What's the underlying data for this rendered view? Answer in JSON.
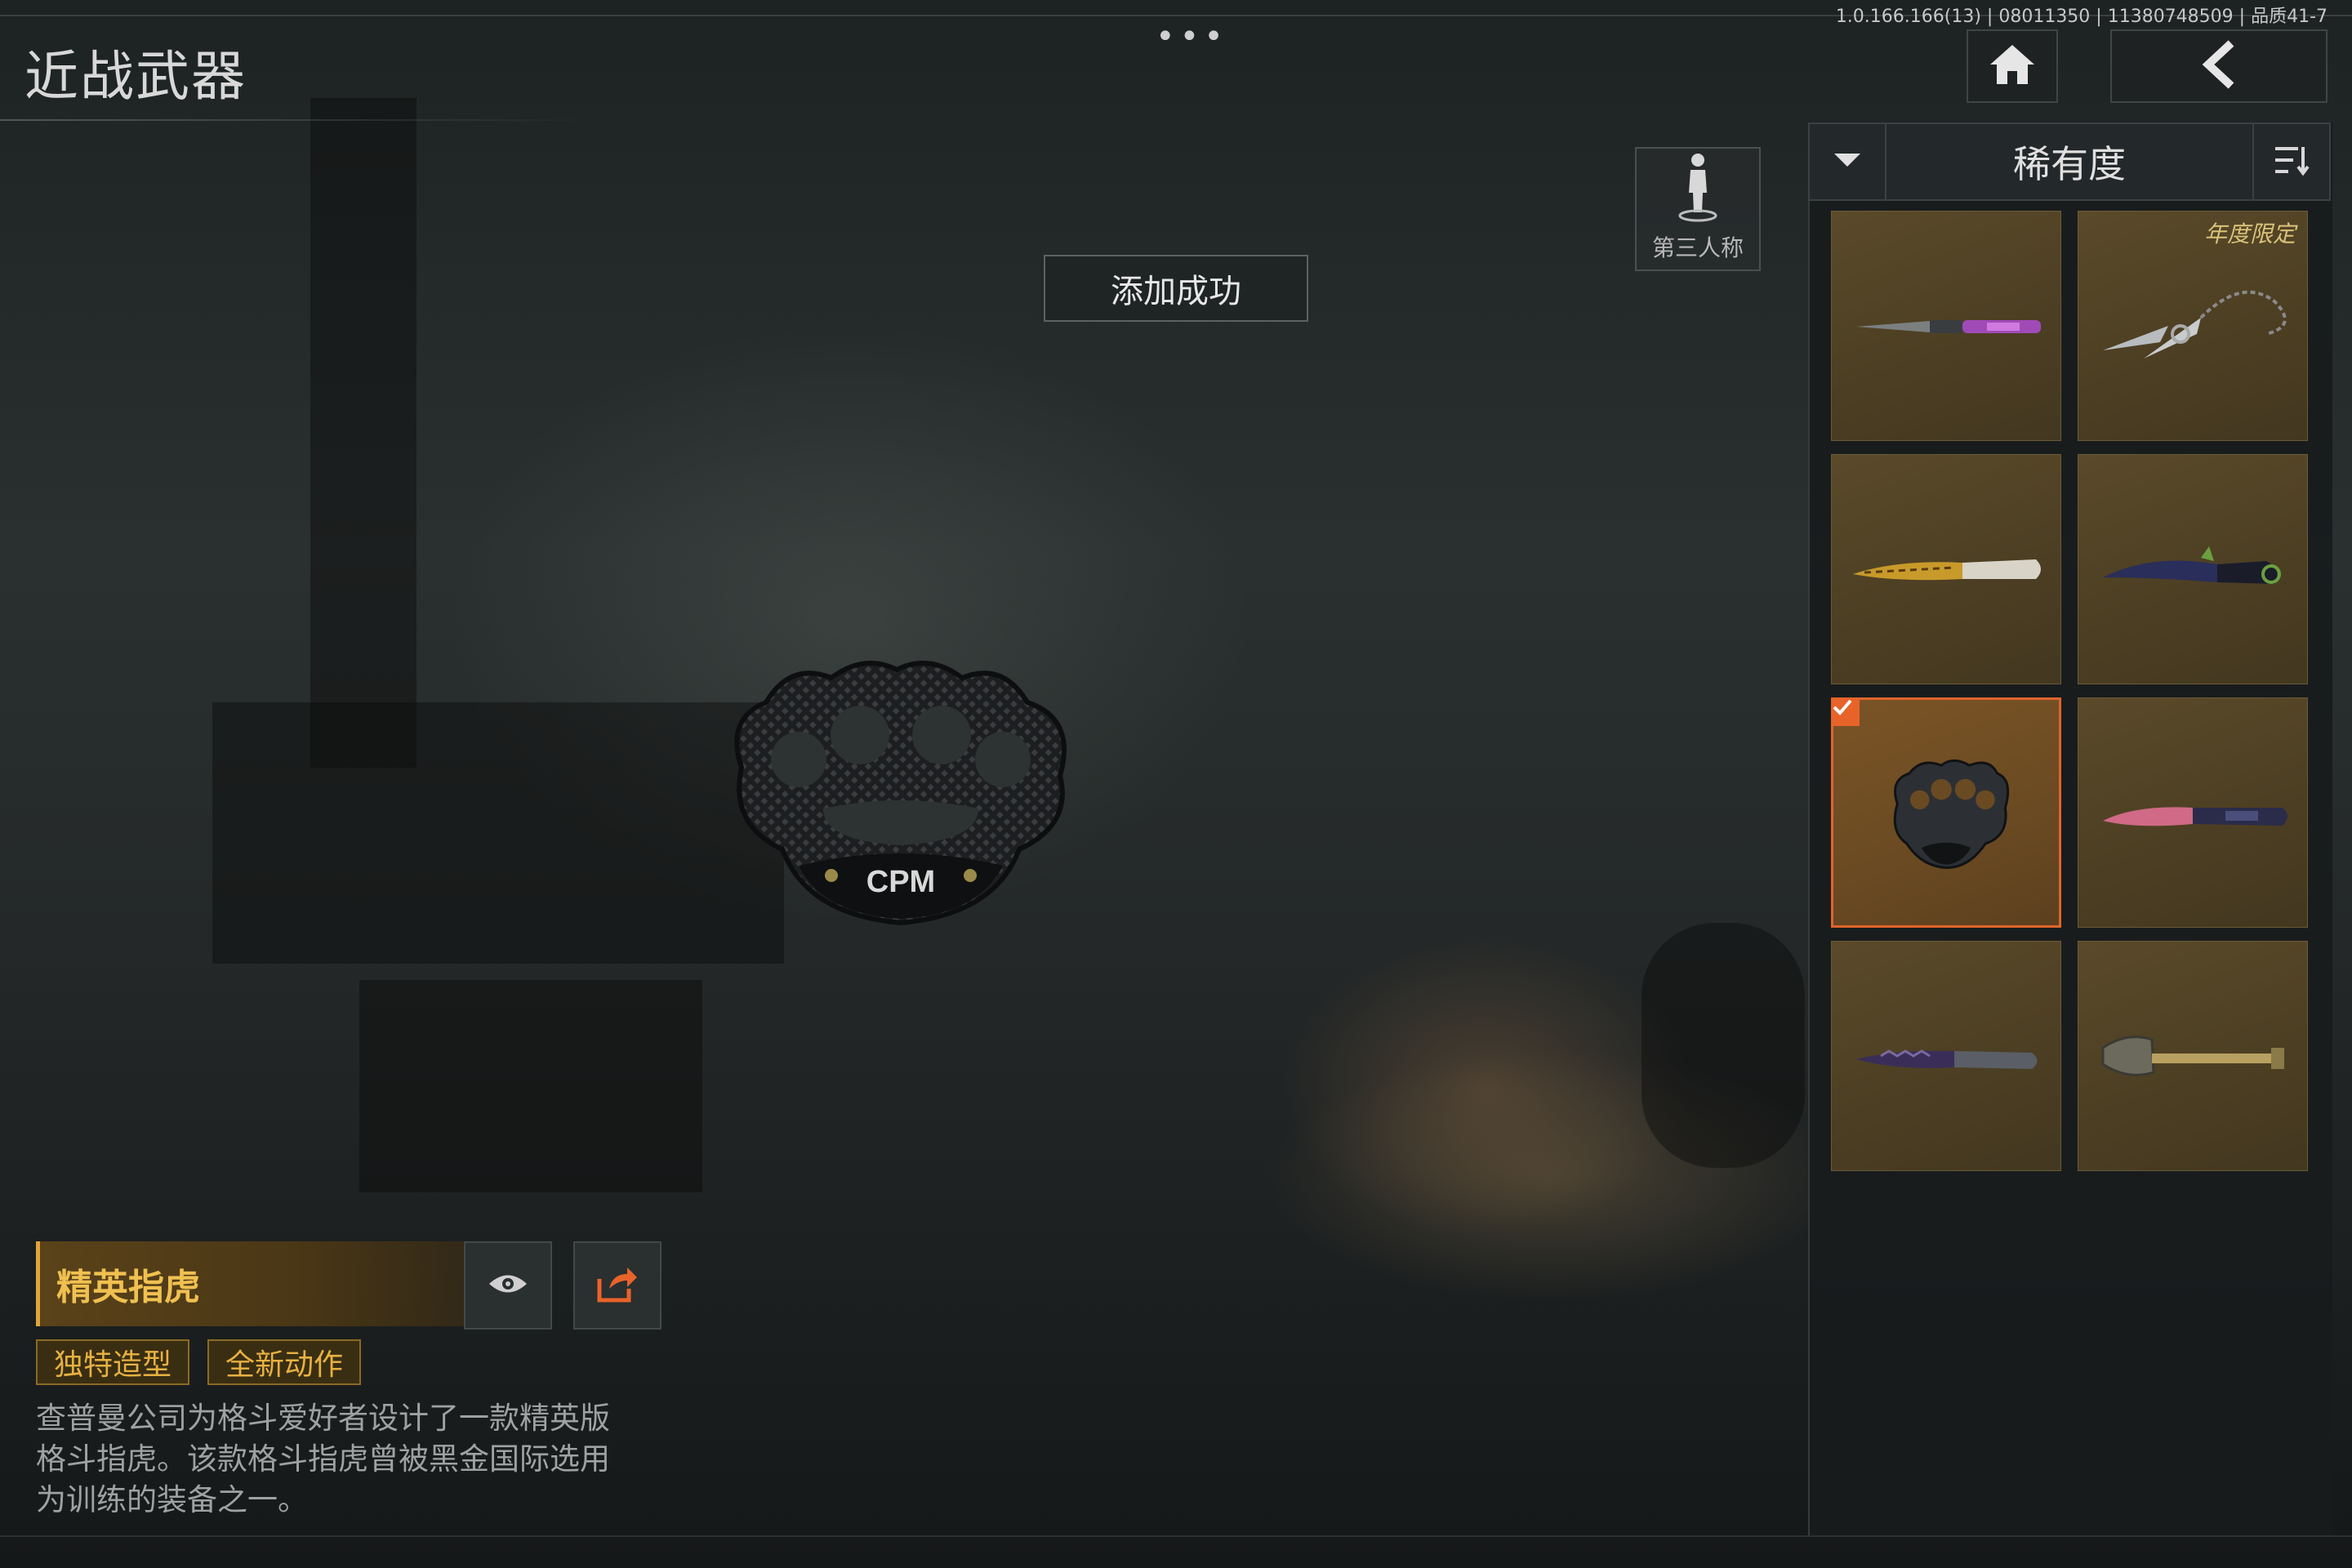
{
  "header": {
    "title": "近战武器",
    "menu_dots": "•••",
    "version": "1.0.166.166(13) | 08011350 | 11380748509 | 品质41-7"
  },
  "nav": {
    "home_icon": "home-icon",
    "back_icon": "back-chevron-icon"
  },
  "view_toggle": {
    "label": "第三人称",
    "icon": "person-standing-icon"
  },
  "toast": {
    "text": "添加成功"
  },
  "sort": {
    "title": "稀有度",
    "dropdown_icon": "caret-down-icon",
    "order_icon": "sort-order-icon"
  },
  "inventory": {
    "items": [
      {
        "icon": "purple-dagger-icon"
      },
      {
        "icon": "chained-blades-icon",
        "badge": "年度限定"
      },
      {
        "icon": "gold-pattern-knife-icon"
      },
      {
        "icon": "dark-karambit-icon"
      },
      {
        "icon": "brass-knuckles-icon",
        "selected": true
      },
      {
        "icon": "pink-tactical-knife-icon"
      },
      {
        "icon": "serrated-dark-knife-icon"
      },
      {
        "icon": "shovel-icon"
      }
    ]
  },
  "weapon": {
    "name": "精英指虎",
    "logo_text": "CPM",
    "tags": [
      "独特造型",
      "全新动作"
    ],
    "description": [
      "查普曼公司为格斗爱好者设计了一款精英版",
      "格斗指虎。该款格斗指虎曾被黑金国际选用",
      "为训练的装备之一。"
    ]
  },
  "colors": {
    "accent_orange": "#e8632a",
    "gold_text": "#f0c050",
    "card_bg": "#5a4a2a"
  }
}
